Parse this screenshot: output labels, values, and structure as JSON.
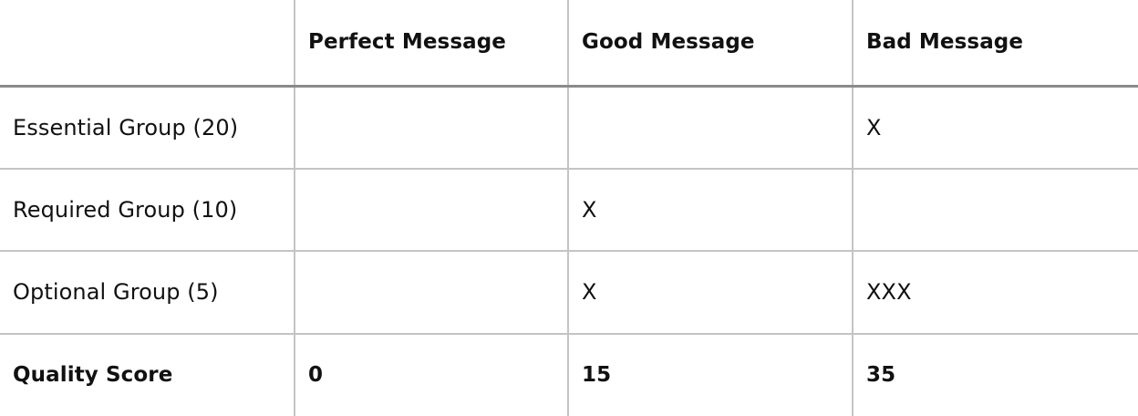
{
  "header": {
    "corner": "",
    "columns": [
      "Perfect Message",
      "Good Message",
      "Bad Message"
    ]
  },
  "rows": [
    {
      "label": "Essential Group (20)",
      "cells": [
        "",
        "",
        "X"
      ]
    },
    {
      "label": "Required Group (10)",
      "cells": [
        "",
        "X",
        ""
      ]
    },
    {
      "label": "Optional Group (5)",
      "cells": [
        "",
        "X",
        "XXX"
      ]
    }
  ],
  "score": {
    "label": "Quality Score",
    "values": [
      "0",
      "15",
      "35"
    ]
  },
  "colors": {
    "grid_line": "#c4c4c4",
    "header_rule": "#8a8a8a",
    "text": "#111111",
    "background": "#ffffff"
  }
}
